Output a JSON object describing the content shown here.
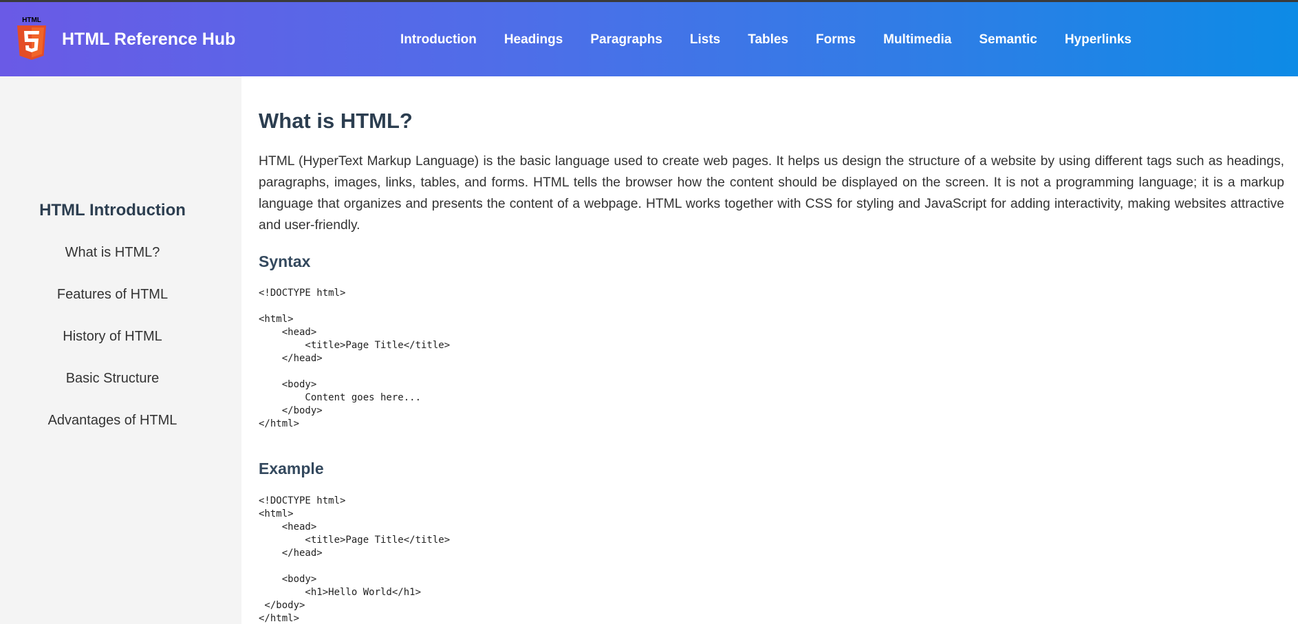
{
  "header": {
    "logo_text": "HTML",
    "logo_number": "5",
    "brand": "HTML Reference Hub",
    "nav": [
      {
        "label": "Introduction"
      },
      {
        "label": "Headings"
      },
      {
        "label": "Paragraphs"
      },
      {
        "label": "Lists"
      },
      {
        "label": "Tables"
      },
      {
        "label": "Forms"
      },
      {
        "label": "Multimedia"
      },
      {
        "label": "Semantic"
      },
      {
        "label": "Hyperlinks"
      }
    ]
  },
  "sidebar": {
    "title": "HTML Introduction",
    "items": [
      {
        "label": "What is HTML?"
      },
      {
        "label": "Features of HTML"
      },
      {
        "label": "History of HTML"
      },
      {
        "label": "Basic Structure"
      },
      {
        "label": "Advantages of HTML"
      }
    ]
  },
  "main": {
    "title": "What is HTML?",
    "intro": "HTML (HyperText Markup Language) is the basic language used to create web pages. It helps us design the structure of a website by using different tags such as headings, paragraphs, images, links, tables, and forms. HTML tells the browser how the content should be displayed on the screen. It is not a programming language; it is a markup language that organizes and presents the content of a webpage. HTML works together with CSS for styling and JavaScript for adding interactivity, making websites attractive and user-friendly.",
    "syntax_title": "Syntax",
    "syntax_code": "<!DOCTYPE html>\n\n<html>\n    <head>\n        <title>Page Title</title>\n    </head>\n\n    <body>\n        Content goes here...\n    </body>\n</html>",
    "example_title": "Example",
    "example_code": "<!DOCTYPE html>\n<html>\n    <head>\n        <title>Page Title</title>\n    </head>\n\n    <body>\n        <h1>Hello World</h1>\n </body>\n</html>"
  },
  "colors": {
    "header_gradient_start": "#6a5ae6",
    "header_gradient_end": "#0d8be6",
    "logo_orange": "#e44d26",
    "sidebar_bg": "#f4f4f4",
    "heading": "#2c3e50"
  }
}
